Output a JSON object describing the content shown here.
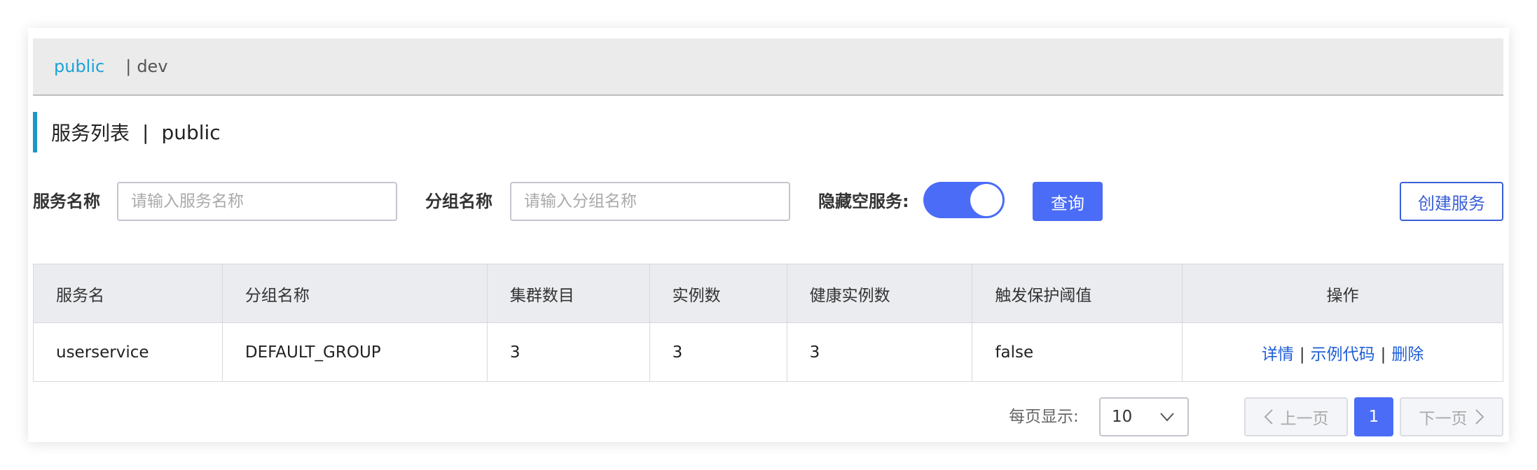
{
  "namespace_bar": {
    "active": "public",
    "separator": "|",
    "other": "dev"
  },
  "page_title": {
    "text": "服务列表",
    "separator": "|",
    "namespace": "public"
  },
  "filters": {
    "service_name_label": "服务名称",
    "service_name_placeholder": "请输入服务名称",
    "group_name_label": "分组名称",
    "group_name_placeholder": "请输入分组名称",
    "hide_empty_label": "隐藏空服务:",
    "hide_empty_on": true,
    "query_button": "查询",
    "create_button": "创建服务"
  },
  "table": {
    "headers": [
      "服务名",
      "分组名称",
      "集群数目",
      "实例数",
      "健康实例数",
      "触发保护阈值",
      "操作"
    ],
    "rows": [
      {
        "service": "userservice",
        "group": "DEFAULT_GROUP",
        "clusters": "3",
        "instances": "3",
        "healthy": "3",
        "threshold": "false",
        "actions": [
          "详情",
          "示例代码",
          "删除"
        ],
        "action_separator": "|"
      }
    ]
  },
  "pagination": {
    "per_page_label": "每页显示:",
    "per_page_value": "10",
    "prev_label": "上一页",
    "current_page": "1",
    "next_label": "下一页"
  },
  "colors": {
    "accent": "#4a6cf7",
    "namespace_active": "#1ca3d8",
    "link": "#1f5fd6"
  }
}
